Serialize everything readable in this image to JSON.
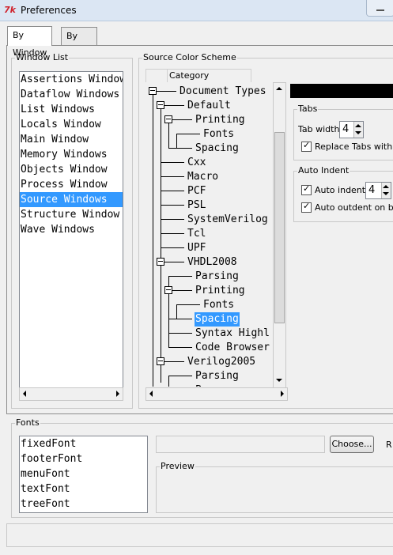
{
  "window": {
    "title": "Preferences",
    "icon_text": "7k"
  },
  "tabs": [
    {
      "label": "By Window",
      "active": true
    },
    {
      "label": "By Name",
      "active": false
    }
  ],
  "window_list": {
    "label": "Window List",
    "items": [
      "Assertions Window",
      "Dataflow Windows",
      "List Windows",
      "Locals Window",
      "Main Window",
      "Memory Windows",
      "Objects Window",
      "Process Window",
      "Source Windows",
      "Structure Window",
      "Wave Windows"
    ],
    "selected": "Source Windows"
  },
  "source_color_scheme": {
    "label": "Source Color Scheme",
    "column_header": "Category",
    "tree": [
      {
        "label": "Document Types",
        "level": 0,
        "expanded": true
      },
      {
        "label": "Default",
        "level": 1,
        "expanded": true
      },
      {
        "label": "Printing",
        "level": 2,
        "expanded": true
      },
      {
        "label": "Fonts",
        "level": 3
      },
      {
        "label": "Spacing",
        "level": 2
      },
      {
        "label": "Cxx",
        "level": 1
      },
      {
        "label": "Macro",
        "level": 1
      },
      {
        "label": "PCF",
        "level": 1
      },
      {
        "label": "PSL",
        "level": 1
      },
      {
        "label": "SystemVerilog",
        "level": 1
      },
      {
        "label": "Tcl",
        "level": 1
      },
      {
        "label": "UPF",
        "level": 1
      },
      {
        "label": "VHDL2008",
        "level": 1,
        "expanded": true
      },
      {
        "label": "Parsing",
        "level": 2
      },
      {
        "label": "Printing",
        "level": 2,
        "expanded": true
      },
      {
        "label": "Fonts",
        "level": 3
      },
      {
        "label": "Spacing",
        "level": 2,
        "selected": true
      },
      {
        "label": "Syntax Highl",
        "level": 2
      },
      {
        "label": "Code Browser",
        "level": 2
      },
      {
        "label": "Verilog2005",
        "level": 1,
        "expanded": true
      },
      {
        "label": "Parsing",
        "level": 2
      },
      {
        "label": "P",
        "level": 2
      }
    ]
  },
  "tabs_group": {
    "label": "Tabs",
    "tab_width_label": "Tab width:",
    "tab_width_value": "4",
    "replace_tabs_label": "Replace Tabs with sp",
    "replace_tabs_checked": true
  },
  "auto_indent_group": {
    "label": "Auto Indent",
    "auto_indent_label": "Auto indent:",
    "auto_indent_checked": true,
    "auto_indent_value": "4",
    "auto_outdent_label": "Auto outdent on bac",
    "auto_outdent_checked": true
  },
  "fonts": {
    "label": "Fonts",
    "items": [
      "fixedFont",
      "footerFont",
      "menuFont",
      "textFont",
      "treeFont"
    ],
    "choose_button": "Choose...",
    "reset_button_partial": "R",
    "preview_label": "Preview"
  },
  "colors": {
    "selection": "#3399ff",
    "color_swatch": "#000000"
  }
}
